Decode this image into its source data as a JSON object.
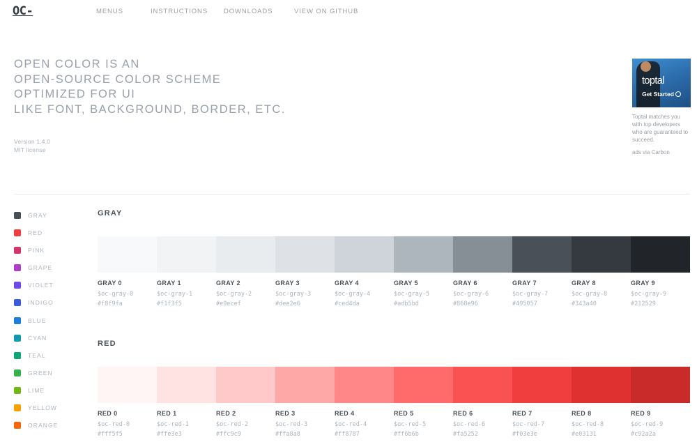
{
  "header": {
    "logo": "OC-",
    "nav": [
      {
        "label": "MENUS",
        "name": "nav-menus"
      },
      {
        "label": "INSTRUCTIONS",
        "name": "nav-instructions"
      },
      {
        "label": "DOWNLOADS",
        "name": "nav-downloads"
      },
      {
        "label": "VIEW ON GITHUB",
        "name": "nav-view-on-github"
      }
    ]
  },
  "hero": {
    "lines": [
      "OPEN COLOR IS AN",
      "OPEN-SOURCE COLOR SCHEME",
      "OPTIMIZED FOR UI",
      "LIKE FONT, BACKGROUND, BORDER, ETC."
    ],
    "version": "Version 1.4.0",
    "license": "MIT license"
  },
  "ad": {
    "brand": "toptal",
    "cta": "Get Started",
    "text": "Toptal matches you with top developers who are guaranteed to succeed.",
    "via": "ads via Carbon"
  },
  "sidebar": {
    "items": [
      {
        "label": "GRAY",
        "color": "#495057"
      },
      {
        "label": "RED",
        "color": "#f03e3e"
      },
      {
        "label": "PINK",
        "color": "#d6336c"
      },
      {
        "label": "GRAPE",
        "color": "#ae3ec9"
      },
      {
        "label": "VIOLET",
        "color": "#7048e8"
      },
      {
        "label": "INDIGO",
        "color": "#3b5bdb"
      },
      {
        "label": "BLUE",
        "color": "#1c7ed6"
      },
      {
        "label": "CYAN",
        "color": "#1098ad"
      },
      {
        "label": "TEAL",
        "color": "#0ca678"
      },
      {
        "label": "GREEN",
        "color": "#37b24d"
      },
      {
        "label": "LIME",
        "color": "#74b816"
      },
      {
        "label": "YELLOW",
        "color": "#f59f00"
      },
      {
        "label": "ORANGE",
        "color": "#f76707"
      }
    ]
  },
  "sections": [
    {
      "title": "GRAY",
      "swatches": [
        {
          "name": "GRAY 0",
          "var": "$oc-gray-0",
          "hex": "#f8f9fa"
        },
        {
          "name": "GRAY 1",
          "var": "$oc-gray-1",
          "hex": "#f1f3f5"
        },
        {
          "name": "GRAY 2",
          "var": "$oc-gray-2",
          "hex": "#e9ecef"
        },
        {
          "name": "GRAY 3",
          "var": "$oc-gray-3",
          "hex": "#dee2e6"
        },
        {
          "name": "GRAY 4",
          "var": "$oc-gray-4",
          "hex": "#ced4da"
        },
        {
          "name": "GRAY 5",
          "var": "$oc-gray-5",
          "hex": "#adb5bd"
        },
        {
          "name": "GRAY 6",
          "var": "$oc-gray-6",
          "hex": "#868e96"
        },
        {
          "name": "GRAY 7",
          "var": "$oc-gray-7",
          "hex": "#495057"
        },
        {
          "name": "GRAY 8",
          "var": "$oc-gray-8",
          "hex": "#343a40"
        },
        {
          "name": "GRAY 9",
          "var": "$oc-gray-9",
          "hex": "#212529"
        }
      ]
    },
    {
      "title": "RED",
      "swatches": [
        {
          "name": "RED 0",
          "var": "$oc-red-0",
          "hex": "#fff5f5"
        },
        {
          "name": "RED 1",
          "var": "$oc-red-1",
          "hex": "#ffe3e3"
        },
        {
          "name": "RED 2",
          "var": "$oc-red-2",
          "hex": "#ffc9c9"
        },
        {
          "name": "RED 3",
          "var": "$oc-red-3",
          "hex": "#ffa8a8"
        },
        {
          "name": "RED 4",
          "var": "$oc-red-4",
          "hex": "#ff8787"
        },
        {
          "name": "RED 5",
          "var": "$oc-red-5",
          "hex": "#ff6b6b"
        },
        {
          "name": "RED 6",
          "var": "$oc-red-6",
          "hex": "#fa5252"
        },
        {
          "name": "RED 7",
          "var": "$oc-red-7",
          "hex": "#f03e3e"
        },
        {
          "name": "RED 8",
          "var": "$oc-red-8",
          "hex": "#e03131"
        },
        {
          "name": "RED 9",
          "var": "$oc-red-9",
          "hex": "#c92a2a"
        }
      ]
    }
  ]
}
